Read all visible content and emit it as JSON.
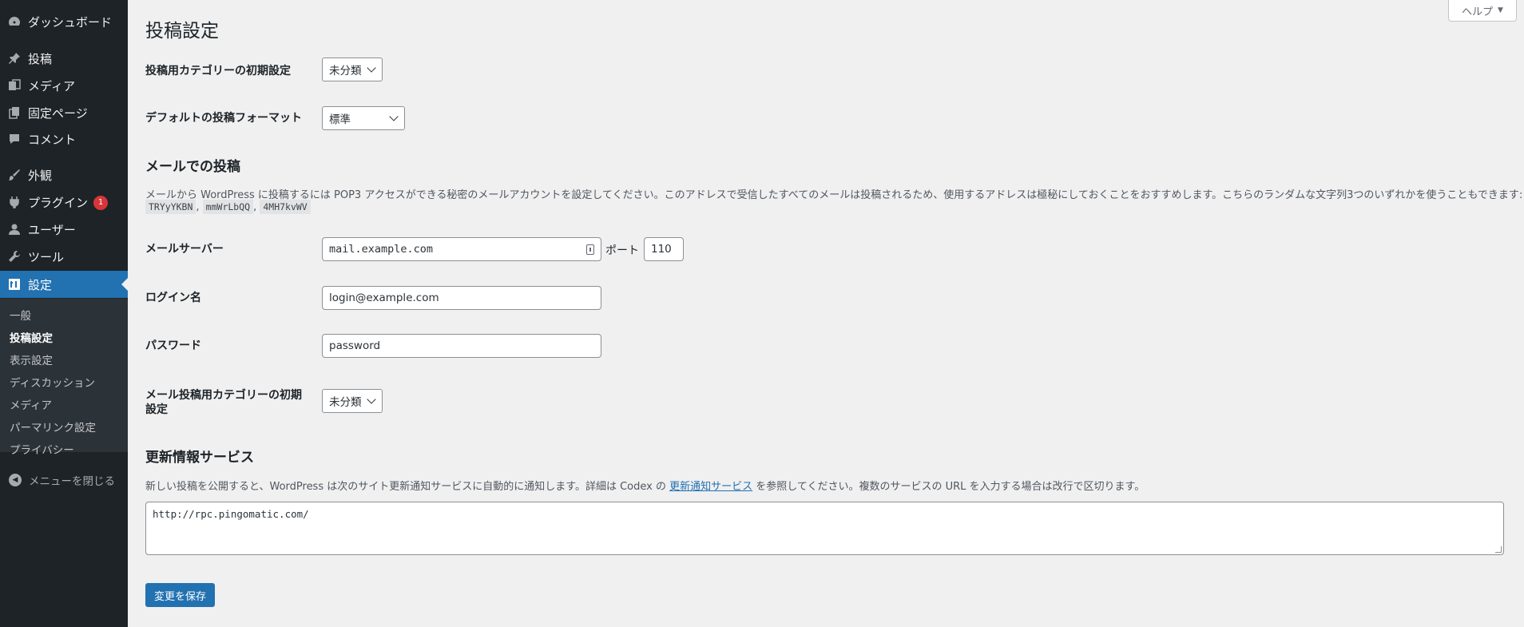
{
  "sidebar": {
    "items": [
      {
        "label": "ダッシュボード",
        "icon": "dashboard-icon"
      },
      {
        "label": "投稿",
        "icon": "pin-icon"
      },
      {
        "label": "メディア",
        "icon": "media-icon"
      },
      {
        "label": "固定ページ",
        "icon": "page-icon"
      },
      {
        "label": "コメント",
        "icon": "comment-icon"
      },
      {
        "label": "外観",
        "icon": "brush-icon"
      },
      {
        "label": "プラグイン",
        "icon": "plugin-icon",
        "badge": "1"
      },
      {
        "label": "ユーザー",
        "icon": "user-icon"
      },
      {
        "label": "ツール",
        "icon": "wrench-icon"
      },
      {
        "label": "設定",
        "icon": "settings-icon",
        "active": true
      }
    ],
    "submenu": [
      "一般",
      "投稿設定",
      "表示設定",
      "ディスカッション",
      "メディア",
      "パーマリンク設定",
      "プライバシー"
    ],
    "collapse_label": "メニューを閉じる",
    "colors": {
      "background": "#1d2327",
      "active": "#2271b1",
      "badge": "#d63638"
    }
  },
  "header": {
    "help_label": "ヘルプ",
    "page_title": "投稿設定"
  },
  "writing": {
    "default_category": {
      "label": "投稿用カテゴリーの初期設定",
      "value": "未分類"
    },
    "default_format": {
      "label": "デフォルトの投稿フォーマット",
      "value": "標準"
    }
  },
  "post_via_email": {
    "title": "メールでの投稿",
    "description": "メールから WordPress に投稿するには POP3 アクセスができる秘密のメールアカウントを設定してください。このアドレスで受信したすべてのメールは投稿されるため、使用するアドレスは極秘にしておくことをおすすめします。こちらのランダムな文字列3つのいずれかを使うこともできます:",
    "random_strings": [
      "TRYyYKBN",
      "mmWrLbQQ",
      "4MH7kvWV"
    ],
    "separator": ",",
    "mail_server": {
      "label": "メールサーバー",
      "value": "mail.example.com"
    },
    "port": {
      "label": "ポート",
      "value": "110"
    },
    "login": {
      "label": "ログイン名",
      "value": "login@example.com"
    },
    "password": {
      "label": "パスワード",
      "value": "password"
    },
    "mail_category": {
      "label_line1": "メール投稿用カテゴリーの初期",
      "label_line2": "設定",
      "value": "未分類"
    }
  },
  "update_services": {
    "title": "更新情報サービス",
    "desc_before": "新しい投稿を公開すると、WordPress は次のサイト更新通知サービスに自動的に通知します。詳細は Codex の ",
    "link_text": "更新通知サービス",
    "desc_after": " を参照してください。複数のサービスの URL を入力する場合は改行で区切ります。",
    "textarea_value": "http://rpc.pingomatic.com/"
  },
  "save_label": "変更を保存"
}
